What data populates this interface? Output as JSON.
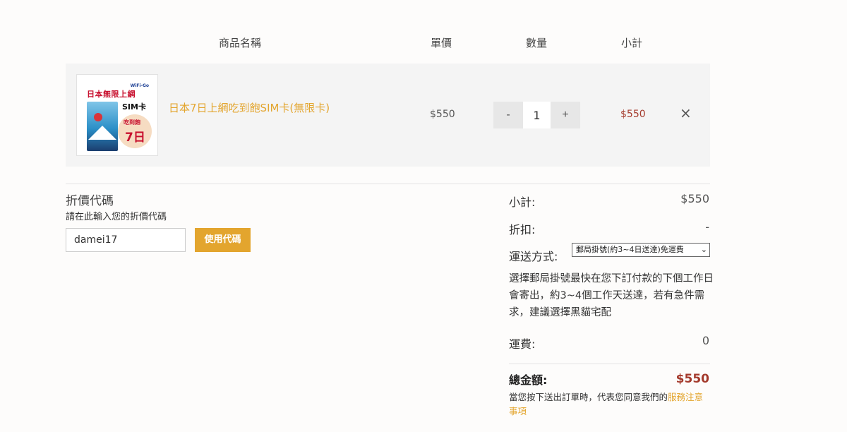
{
  "headers": {
    "name": "商品名稱",
    "price": "單價",
    "qty": "數量",
    "subtotal": "小計"
  },
  "item": {
    "image": {
      "top_text": "日本無限上網",
      "brand": "WiFi-Go",
      "sim_text": "SIM卡",
      "badge_top": "吃到飽",
      "badge_main": "7日"
    },
    "name": "日本7日上網吃到飽SIM卡(無限卡)",
    "unit_price": "$550",
    "qty_minus": "-",
    "qty_value": "1",
    "qty_plus": "+",
    "subtotal": "$550",
    "remove": "×"
  },
  "coupon": {
    "title": "折價代碼",
    "subtitle": "請在此輸入您的折價代碼",
    "value": "damei17",
    "button": "使用代碼"
  },
  "summary": {
    "subtotal_label": "小計:",
    "subtotal_value": "$550",
    "discount_label": "折扣:",
    "discount_value": "-",
    "shipping_label": "運送方式:",
    "shipping_selected": "郵局掛號(約3~4日送達)免運費",
    "shipping_desc": "選擇郵局掛號最快在您下訂付款的下個工作日會寄出，約3~4個工作天送達，若有急件需求，建議選擇黑貓宅配",
    "fee_label": "運費:",
    "fee_value": "0",
    "total_label": "總金額:",
    "total_value": "$550",
    "agree_text": "當您按下送出訂單時，代表您同意我們的",
    "agree_link": "服務注意事項"
  },
  "colors": {
    "accent": "#e3a52e",
    "price_red": "#a43a2c"
  }
}
